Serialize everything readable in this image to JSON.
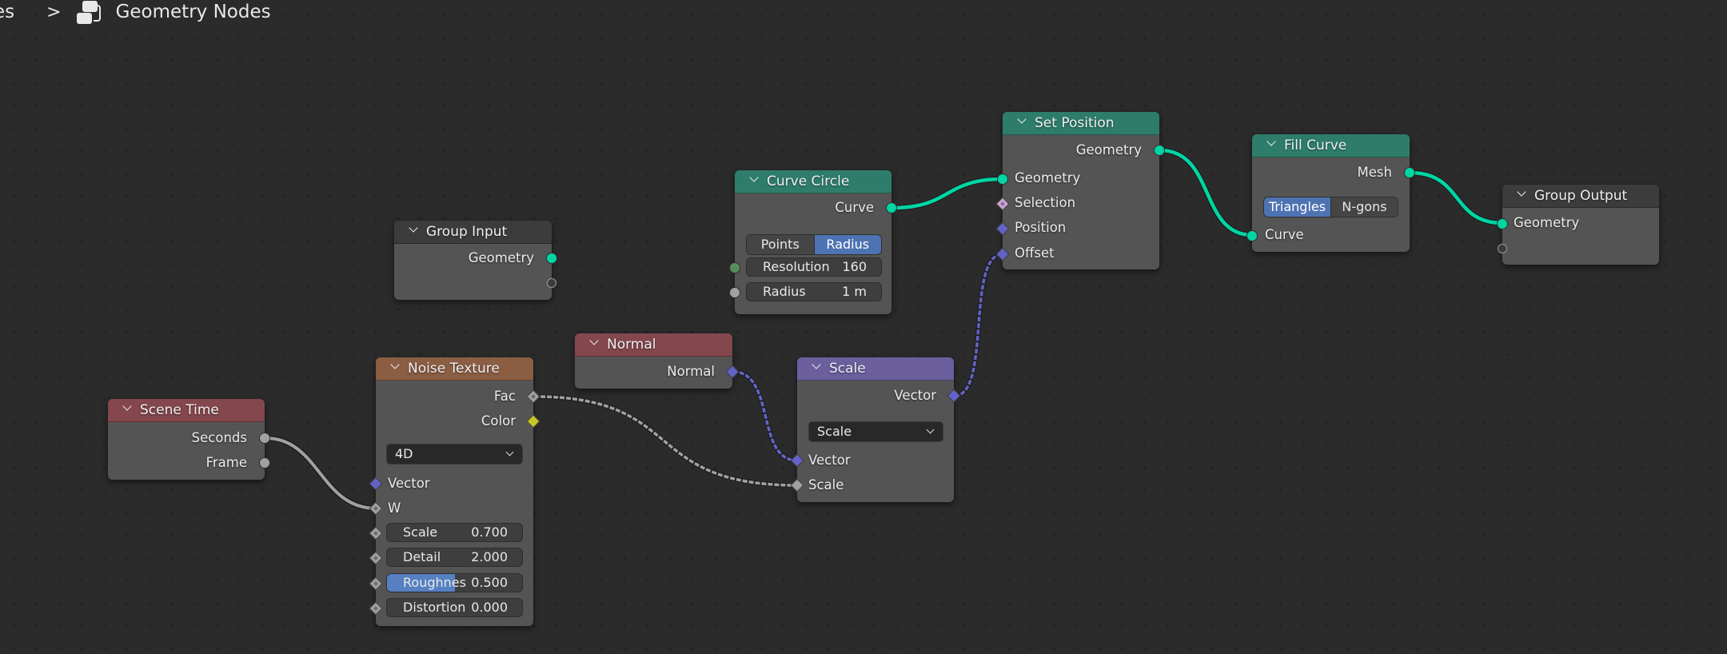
{
  "breadcrumb": {
    "previous": "es",
    "separator": ">",
    "icon": "node-tree-icon",
    "current": "Geometry Nodes"
  },
  "colors": {
    "geometry_socket": "#00d6a3",
    "vector_socket": "#6363c7",
    "float_socket": "#a1a1a1",
    "color_socket": "#c7c729",
    "int_socket": "#598c5c",
    "bool_socket": "#cca6d6",
    "header_input": "#83474d",
    "header_texture": "#8b5d43",
    "header_geometry": "#2e7d6b",
    "header_vector": "#6b5f9e",
    "header_group": "#3c3c3c",
    "active_button": "#4e73b3"
  },
  "nodes": {
    "scene_time": {
      "title": "Scene Time",
      "outputs": [
        "Seconds",
        "Frame"
      ]
    },
    "group_input": {
      "title": "Group Input",
      "outputs": [
        "Geometry"
      ]
    },
    "noise_texture": {
      "title": "Noise Texture",
      "outputs": [
        "Fac",
        "Color"
      ],
      "dimensions": "4D",
      "inputs": [
        "Vector",
        "W"
      ],
      "fields": [
        {
          "label": "Scale",
          "value": "0.700"
        },
        {
          "label": "Detail",
          "value": "2.000"
        },
        {
          "label": "Roughnes",
          "value": "0.500",
          "fill": 0.5
        },
        {
          "label": "Distortion",
          "value": "0.000"
        }
      ]
    },
    "normal": {
      "title": "Normal",
      "outputs": [
        "Normal"
      ]
    },
    "curve_circle": {
      "title": "Curve Circle",
      "outputs": [
        "Curve"
      ],
      "mode_options": [
        "Points",
        "Radius"
      ],
      "mode_selected": "Radius",
      "fields": [
        {
          "label": "Resolution",
          "value": "160"
        },
        {
          "label": "Radius",
          "value": "1 m"
        }
      ]
    },
    "scale": {
      "title": "Scale",
      "outputs": [
        "Vector"
      ],
      "operation": "Scale",
      "inputs": [
        "Vector",
        "Scale"
      ]
    },
    "set_position": {
      "title": "Set Position",
      "outputs": [
        "Geometry"
      ],
      "inputs": [
        "Geometry",
        "Selection",
        "Position",
        "Offset"
      ]
    },
    "fill_curve": {
      "title": "Fill Curve",
      "outputs": [
        "Mesh"
      ],
      "mode_options": [
        "Triangles",
        "N-gons"
      ],
      "mode_selected": "Triangles",
      "inputs": [
        "Curve"
      ]
    },
    "group_output": {
      "title": "Group Output",
      "inputs": [
        "Geometry"
      ]
    }
  },
  "links": [
    {
      "from": "Scene Time.Seconds",
      "to": "Noise Texture.W",
      "type": "float"
    },
    {
      "from": "Noise Texture.Fac",
      "to": "Scale.Scale",
      "type": "float-field"
    },
    {
      "from": "Normal.Normal",
      "to": "Scale.Vector",
      "type": "vector-field"
    },
    {
      "from": "Scale.Vector",
      "to": "Set Position.Offset",
      "type": "vector-field"
    },
    {
      "from": "Curve Circle.Curve",
      "to": "Set Position.Geometry",
      "type": "geometry"
    },
    {
      "from": "Set Position.Geometry",
      "to": "Fill Curve.Curve",
      "type": "geometry"
    },
    {
      "from": "Fill Curve.Mesh",
      "to": "Group Output.Geometry",
      "type": "geometry"
    }
  ]
}
